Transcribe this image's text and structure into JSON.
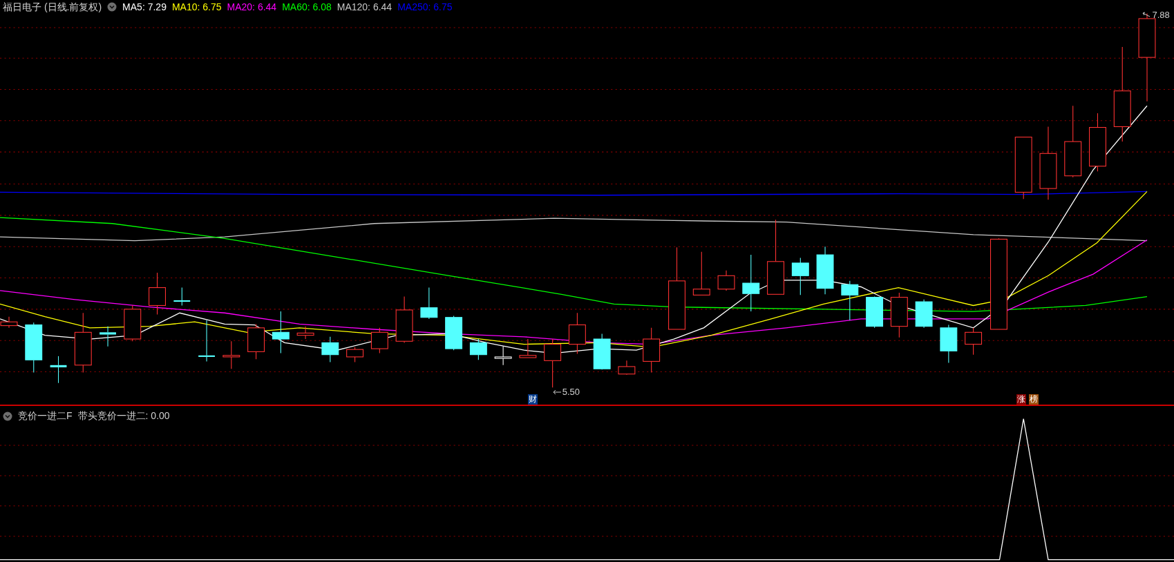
{
  "main_panel": {
    "title": "福日电子",
    "period": "(日线.前复权)",
    "ma_legend": [
      {
        "text": "MA5: 7.29",
        "color": "#ffffff"
      },
      {
        "text": "MA10: 6.75",
        "color": "#ffff00"
      },
      {
        "text": "MA20: 6.44",
        "color": "#ff00ff"
      },
      {
        "text": "MA60: 6.08",
        "color": "#00ff00"
      },
      {
        "text": "MA120: 6.44",
        "color": "#c8c8c8"
      },
      {
        "text": "MA250: 6.75",
        "color": "#0000ff"
      }
    ],
    "high_label": "7.88",
    "low_label": "5.50",
    "markers": [
      {
        "text": "财",
        "kind": "finance"
      },
      {
        "text": "涨",
        "kind": "limit"
      },
      {
        "text": "榜",
        "kind": "rank"
      }
    ]
  },
  "indicator_panel": {
    "name": "竞价一进二F",
    "reading": "带头竞价一进二: 0.00"
  }
}
